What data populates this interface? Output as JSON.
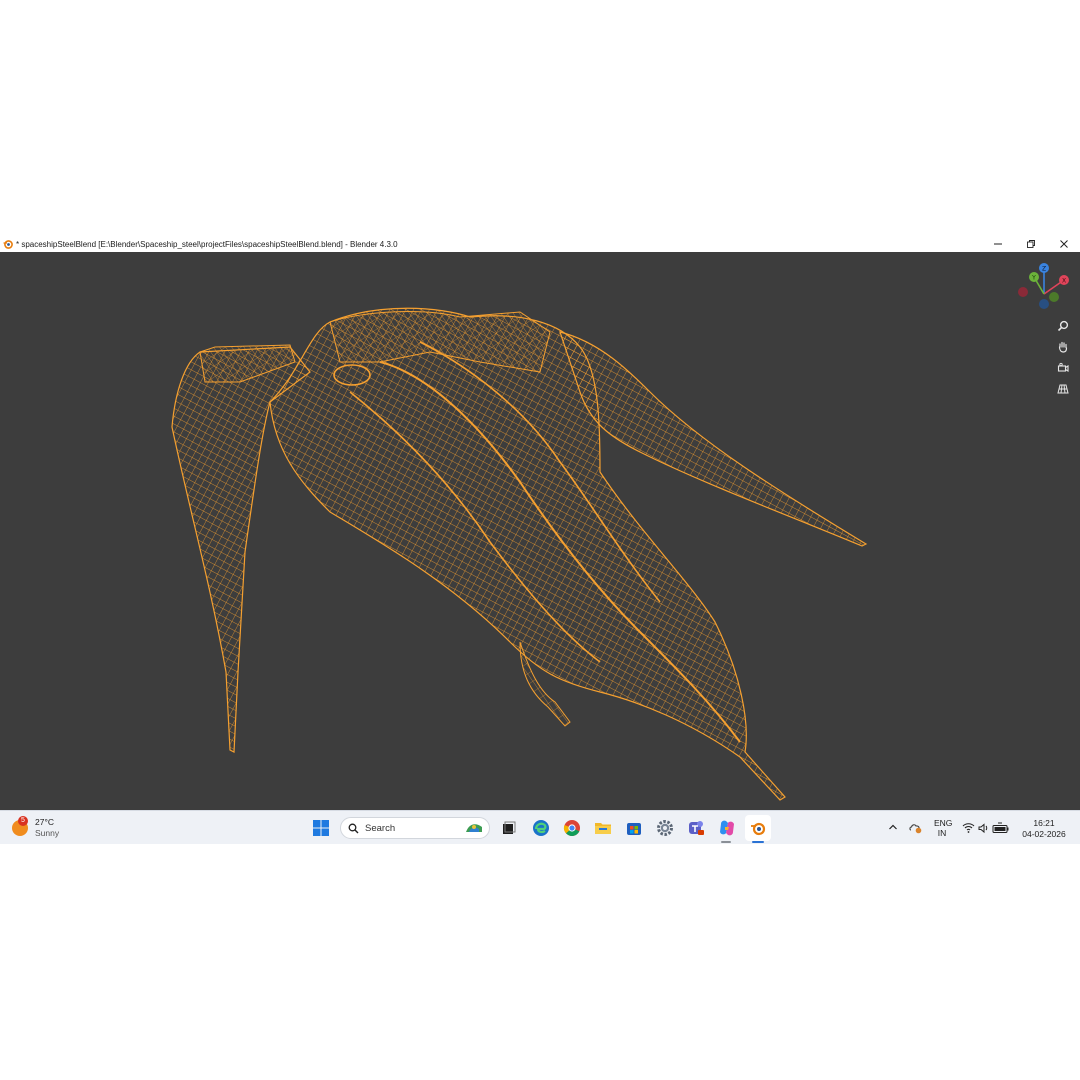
{
  "window": {
    "title": "* spaceshipSteelBlend [E:\\Blender\\Spaceship_steel\\projectFiles\\spaceshipSteelBlend.blend] - Blender 4.3.0",
    "app_icon": "blender-icon",
    "controls": [
      "minimize-icon",
      "restore-icon",
      "close-icon"
    ]
  },
  "viewport": {
    "background": "#3d3d3d",
    "wireframe_color": "#f5a030",
    "gizmo_axes": [
      "X",
      "Y",
      "Z"
    ],
    "gizmo_colors": {
      "x": "#e0445a",
      "y": "#6cb33a",
      "z": "#3a84e0"
    },
    "nav_buttons": [
      "zoom-icon",
      "pan-hand-icon",
      "camera-view-icon",
      "grid-view-icon"
    ]
  },
  "taskbar": {
    "weather": {
      "temp": "27°C",
      "condition": "Sunny",
      "badge": "5"
    },
    "search_label": "Search",
    "apps": [
      "start-icon",
      "search-icon",
      "task-view-icon",
      "edge-icon",
      "chrome-icon",
      "file-explorer-icon",
      "store-icon",
      "settings-icon",
      "teams-icon",
      "copilot-icon",
      "blender-icon"
    ],
    "tray": {
      "language_top": "ENG",
      "language_bottom": "IN",
      "time": "16:21",
      "date": "04-02-2026"
    }
  }
}
